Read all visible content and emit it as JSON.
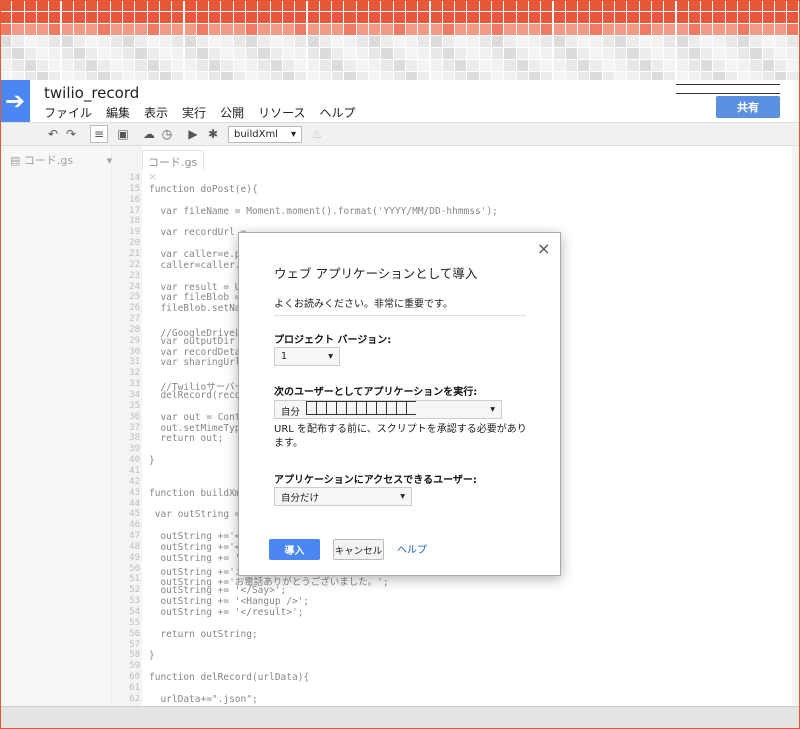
{
  "app": {
    "title": "twilio_record",
    "menu": [
      "ファイル",
      "編集",
      "表示",
      "実行",
      "公開",
      "リソース",
      "ヘルプ"
    ],
    "share_label": "共有"
  },
  "toolbar": {
    "function_select": "buildXml"
  },
  "file_panel": {
    "file_label": "コード.gs"
  },
  "editor": {
    "tab_label": "コード.gs",
    "lines": [
      {
        "n": "14",
        "t": ""
      },
      {
        "n": "15",
        "t": "function doPost(e){"
      },
      {
        "n": "16",
        "t": ""
      },
      {
        "n": "17",
        "t": "  var fileName = Moment.moment().format('YYYY/MM/DD-hhmmss');"
      },
      {
        "n": "18",
        "t": ""
      },
      {
        "n": "19",
        "t": "  var recordUrl ="
      },
      {
        "n": "20",
        "t": ""
      },
      {
        "n": "21",
        "t": "  var caller=e.par"
      },
      {
        "n": "22",
        "t": "  caller=caller.re"
      },
      {
        "n": "23",
        "t": ""
      },
      {
        "n": "24",
        "t": "  var result = Url"
      },
      {
        "n": "25",
        "t": "  var fileBlob = "
      },
      {
        "n": "26",
        "t": "  fileBlob.setName"
      },
      {
        "n": "27",
        "t": ""
      },
      {
        "n": "28",
        "t": "  //GoogleDriveに"
      },
      {
        "n": "29",
        "t": "  var outputDir = "
      },
      {
        "n": "30",
        "t": "  var recordDetail"
      },
      {
        "n": "31",
        "t": "  var sharingUrl +"
      },
      {
        "n": "32",
        "t": ""
      },
      {
        "n": "33",
        "t": "  //Twilioサーバー"
      },
      {
        "n": "34",
        "t": "  delRecord(record"
      },
      {
        "n": "35",
        "t": ""
      },
      {
        "n": "36",
        "t": "  var out = Conten"
      },
      {
        "n": "37",
        "t": "  out.setMimeType"
      },
      {
        "n": "38",
        "t": "  return out;"
      },
      {
        "n": "39",
        "t": ""
      },
      {
        "n": "40",
        "t": "}"
      },
      {
        "n": "41",
        "t": ""
      },
      {
        "n": "42",
        "t": ""
      },
      {
        "n": "43",
        "t": "function buildXml("
      },
      {
        "n": "44",
        "t": ""
      },
      {
        "n": "45",
        "t": " var outString ="
      },
      {
        "n": "46",
        "t": ""
      },
      {
        "n": "47",
        "t": "  outString +='<?"
      },
      {
        "n": "48",
        "t": "  outString +='<"
      },
      {
        "n": "49",
        "t": "  outString += '<"
      },
      {
        "n": "50",
        "t": "  outString +='メ"
      },
      {
        "n": "51",
        "t": "  outString +='お電話ありがとうございました。';"
      },
      {
        "n": "52",
        "t": "  outString += '</Say>';"
      },
      {
        "n": "53",
        "t": "  outString += '<Hangup />';"
      },
      {
        "n": "54",
        "t": "  outString += '</result>';"
      },
      {
        "n": "55",
        "t": ""
      },
      {
        "n": "56",
        "t": "  return outString;"
      },
      {
        "n": "57",
        "t": ""
      },
      {
        "n": "58",
        "t": "}"
      },
      {
        "n": "59",
        "t": ""
      },
      {
        "n": "60",
        "t": "function delRecord(urlData){"
      },
      {
        "n": "61",
        "t": ""
      },
      {
        "n": "62",
        "t": "  urlData+=\".json\";"
      }
    ]
  },
  "dialog": {
    "title": "ウェブ アプリケーションとして導入",
    "note": "よくお読みください。非常に重要です。",
    "project_version_label": "プロジェクト バージョン:",
    "project_version_value": "1",
    "run_as_label": "次のユーザーとしてアプリケーションを実行:",
    "run_as_value": "自分",
    "auth_text": "URL を配布する前に、スクリプトを承認する必要があります。",
    "access_label": "アプリケーションにアクセスできるユーザー:",
    "access_value": "自分だけ",
    "deploy_label": "導入",
    "cancel_label": "キャンセル",
    "help_label": "ヘルプ"
  }
}
